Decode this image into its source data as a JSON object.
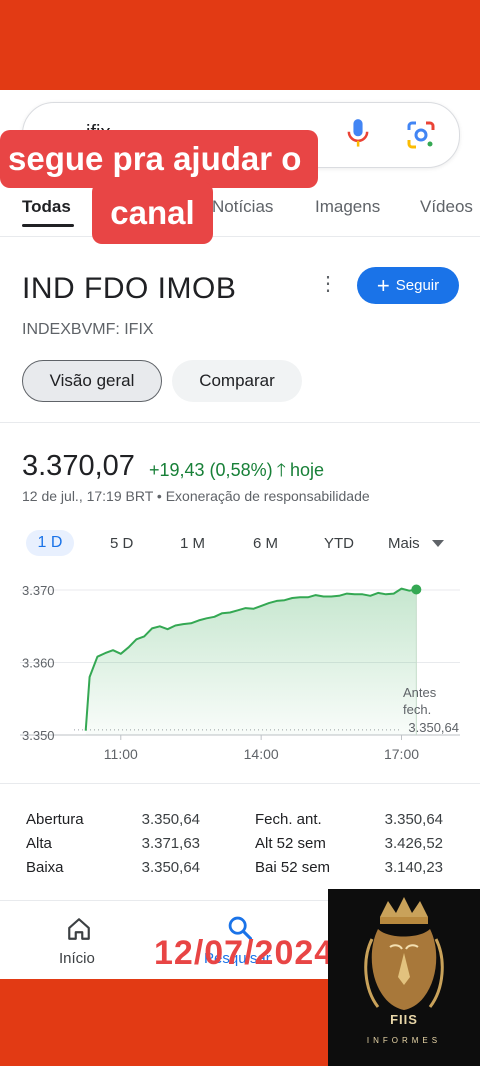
{
  "search": {
    "query": "ifix"
  },
  "overlay": {
    "line1": "segue pra ajudar o",
    "line2": "canal",
    "date": "12/07/2024"
  },
  "tabs": [
    {
      "label": "Todas",
      "active": true
    },
    {
      "label": "Notícias",
      "active": false
    },
    {
      "label": "Imagens",
      "active": false
    },
    {
      "label": "Vídeos",
      "active": false
    }
  ],
  "quote": {
    "title": "IND FDO IMOB",
    "ticker": "INDEXBVMF: IFIX",
    "follow_label": "Seguir",
    "chips": [
      "Visão geral",
      "Comparar"
    ],
    "price": "3.370,07",
    "change": "+19,43 (0,58%)",
    "change_period": "hoje",
    "updated": "12 de jul., 17:19 BRT",
    "disclaimer": "Exoneração de responsabilidade"
  },
  "ranges": [
    "1 D",
    "5 D",
    "1 M",
    "6 M",
    "YTD"
  ],
  "ranges_more": "Mais",
  "chart_data": {
    "type": "area",
    "y_ticks": [
      "3.370",
      "3.360",
      "3.350"
    ],
    "x_ticks": [
      "11:00",
      "14:00",
      "17:00"
    ],
    "ylim": [
      3350,
      3370
    ],
    "previous_close_label": "Antes fech.",
    "previous_close_value": "3.350,64",
    "previous_close": 3350.64,
    "x": [
      "10:15",
      "10:20",
      "10:30",
      "10:40",
      "10:50",
      "11:00",
      "11:10",
      "11:20",
      "11:30",
      "11:40",
      "11:50",
      "12:00",
      "12:10",
      "12:20",
      "12:30",
      "12:40",
      "12:50",
      "13:00",
      "13:10",
      "13:20",
      "13:30",
      "13:40",
      "13:50",
      "14:00",
      "14:10",
      "14:20",
      "14:30",
      "14:40",
      "14:50",
      "15:00",
      "15:10",
      "15:20",
      "15:30",
      "15:40",
      "15:50",
      "16:00",
      "16:10",
      "16:20",
      "16:30",
      "16:40",
      "16:50",
      "17:00",
      "17:10",
      "17:19"
    ],
    "values": [
      3350.6,
      3358.0,
      3360.8,
      3361.3,
      3361.7,
      3361.2,
      3362.1,
      3363.2,
      3363.6,
      3364.7,
      3365.0,
      3364.6,
      3365.1,
      3365.3,
      3365.4,
      3365.8,
      3366.1,
      3366.3,
      3366.8,
      3366.9,
      3367.2,
      3367.5,
      3367.4,
      3367.8,
      3368.2,
      3368.5,
      3368.6,
      3368.9,
      3369.0,
      3369.0,
      3369.3,
      3369.1,
      3369.1,
      3369.2,
      3369.5,
      3369.4,
      3369.4,
      3369.2,
      3369.6,
      3369.4,
      3369.5,
      3370.2,
      3369.9,
      3370.07
    ],
    "line_color": "#34a853"
  },
  "stats": [
    {
      "label": "Abertura",
      "value": "3.350,64"
    },
    {
      "label": "Alta",
      "value": "3.371,63"
    },
    {
      "label": "Baixa",
      "value": "3.350,64"
    },
    {
      "label": "Fech. ant.",
      "value": "3.350,64"
    },
    {
      "label": "Alt 52 sem",
      "value": "3.426,52"
    },
    {
      "label": "Bai 52 sem",
      "value": "3.140,23"
    }
  ],
  "bottom_nav": [
    {
      "label": "Início",
      "icon": "home-icon"
    },
    {
      "label": "Pesquisar",
      "icon": "search-icon"
    }
  ],
  "logo": {
    "main": "FIIS",
    "sub": "INFORMES"
  },
  "colors": {
    "brand_red": "#e23a14",
    "overlay_red": "#e84545",
    "google_blue": "#1a73e8",
    "positive_green": "#188038"
  }
}
